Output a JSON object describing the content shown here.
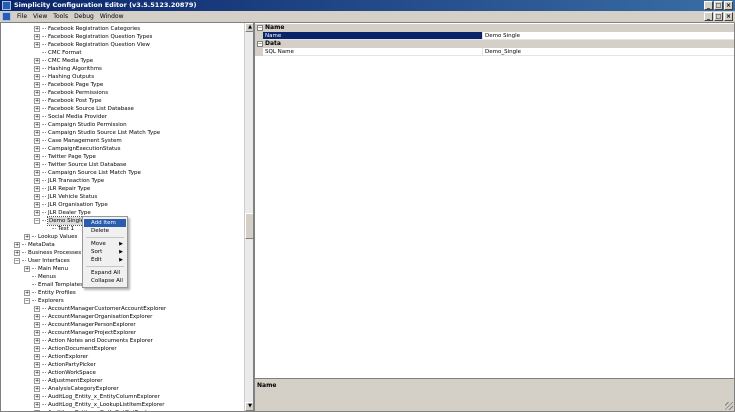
{
  "window": {
    "title": "Simplicity Configuration Editor (v3.5.5123.20879)"
  },
  "menu": [
    "File",
    "View",
    "Tools",
    "Debug",
    "Window"
  ],
  "window_buttons": {
    "minimize": "_",
    "restore": "□",
    "close": "×"
  },
  "tree": [
    {
      "label": "Facebook Registration Categories",
      "indent": 3,
      "exp": "+"
    },
    {
      "label": "Facebook Registration Question Types",
      "indent": 3,
      "exp": "+"
    },
    {
      "label": "Facebook Registration Question View",
      "indent": 3,
      "exp": "+"
    },
    {
      "label": "CMC Format",
      "indent": 3,
      "exp": ""
    },
    {
      "label": "CMC Media Type",
      "indent": 3,
      "exp": "+"
    },
    {
      "label": "Hashing Algorithms",
      "indent": 3,
      "exp": "+"
    },
    {
      "label": "Hashing Outputs",
      "indent": 3,
      "exp": "+"
    },
    {
      "label": "Facebook Page Type",
      "indent": 3,
      "exp": "+"
    },
    {
      "label": "Facebook Permissions",
      "indent": 3,
      "exp": "+"
    },
    {
      "label": "Facebook Post Type",
      "indent": 3,
      "exp": "+"
    },
    {
      "label": "Facebook Source List Database",
      "indent": 3,
      "exp": "+"
    },
    {
      "label": "Social Media Provider",
      "indent": 3,
      "exp": "+"
    },
    {
      "label": "Campaign Studio Permission",
      "indent": 3,
      "exp": "+"
    },
    {
      "label": "Campaign Studio Source List Match Type",
      "indent": 3,
      "exp": "+"
    },
    {
      "label": "Case Management System",
      "indent": 3,
      "exp": "+"
    },
    {
      "label": "CampaignExecutionStatus",
      "indent": 3,
      "exp": "+"
    },
    {
      "label": "Twitter Page Type",
      "indent": 3,
      "exp": "+"
    },
    {
      "label": "Twitter Source List Database",
      "indent": 3,
      "exp": "+"
    },
    {
      "label": "Campaign Source List Match Type",
      "indent": 3,
      "exp": "+"
    },
    {
      "label": "JLR Transaction Type",
      "indent": 3,
      "exp": "+"
    },
    {
      "label": "JLR Repair Type",
      "indent": 3,
      "exp": "+"
    },
    {
      "label": "JLR Vehicle Status",
      "indent": 3,
      "exp": "+"
    },
    {
      "label": "JLR Organisation Type",
      "indent": 3,
      "exp": "+"
    },
    {
      "label": "JLR Dealer Type",
      "indent": 3,
      "exp": "+"
    },
    {
      "label": "Demo Single",
      "indent": 3,
      "exp": "-",
      "selected": true
    },
    {
      "label": "Test 1",
      "indent": 4,
      "exp": ""
    },
    {
      "label": "Lookup Values",
      "indent": 2,
      "exp": "+"
    },
    {
      "label": "MetaData",
      "indent": 1,
      "exp": "+"
    },
    {
      "label": "Business Processes",
      "indent": 1,
      "exp": "+"
    },
    {
      "label": "User Interfaces",
      "indent": 1,
      "exp": "-"
    },
    {
      "label": "Main Menu",
      "indent": 2,
      "exp": "+"
    },
    {
      "label": "Menus",
      "indent": 2,
      "exp": ""
    },
    {
      "label": "Email Templates",
      "indent": 2,
      "exp": ""
    },
    {
      "label": "Entity Profiles",
      "indent": 2,
      "exp": "+"
    },
    {
      "label": "Explorers",
      "indent": 2,
      "exp": "-"
    },
    {
      "label": "AccountManagerCustomerAccountExplorer",
      "indent": 3,
      "exp": "+"
    },
    {
      "label": "AccountManagerOrganisationExplorer",
      "indent": 3,
      "exp": "+"
    },
    {
      "label": "AccountManagerPersonExplorer",
      "indent": 3,
      "exp": "+"
    },
    {
      "label": "AccountManagerProjectExplorer",
      "indent": 3,
      "exp": "+"
    },
    {
      "label": "Action Notes and Documents Explorer",
      "indent": 3,
      "exp": "+"
    },
    {
      "label": "ActionDocumentExplorer",
      "indent": 3,
      "exp": "+"
    },
    {
      "label": "ActionExplorer",
      "indent": 3,
      "exp": "+"
    },
    {
      "label": "ActionPartyPicker",
      "indent": 3,
      "exp": "+"
    },
    {
      "label": "ActionWorkSpace",
      "indent": 3,
      "exp": "+"
    },
    {
      "label": "AdjustmentExplorer",
      "indent": 3,
      "exp": "+"
    },
    {
      "label": "AnalysisCategoryExplorer",
      "indent": 3,
      "exp": "+"
    },
    {
      "label": "AuditLog_Entity_x_EntityColumnExplorer",
      "indent": 3,
      "exp": "+"
    },
    {
      "label": "AuditLog_Entity_x_LookupListItemExplorer",
      "indent": 3,
      "exp": "+"
    },
    {
      "label": "AuditLog_Entity_x_OptInOptOutExplorer",
      "indent": 3,
      "exp": "+"
    }
  ],
  "context_menu": {
    "items": [
      {
        "label": "Add Item",
        "highlighted": true,
        "submenu": false
      },
      {
        "label": "Delete",
        "submenu": false
      },
      {
        "sep": true
      },
      {
        "label": "Move",
        "submenu": true
      },
      {
        "label": "Sort",
        "submenu": true
      },
      {
        "label": "Edit",
        "submenu": true
      },
      {
        "sep": true
      },
      {
        "label": "Expand All",
        "submenu": false
      },
      {
        "label": "Collapse All",
        "submenu": false
      }
    ]
  },
  "properties": {
    "categories": [
      {
        "name": "Name",
        "rows": [
          {
            "name": "Name",
            "value": "Demo Single",
            "selected": true
          }
        ]
      },
      {
        "name": "Data",
        "rows": [
          {
            "name": "SQL Name",
            "value": "Demo_Single"
          }
        ]
      }
    ],
    "description_title": "Name"
  }
}
